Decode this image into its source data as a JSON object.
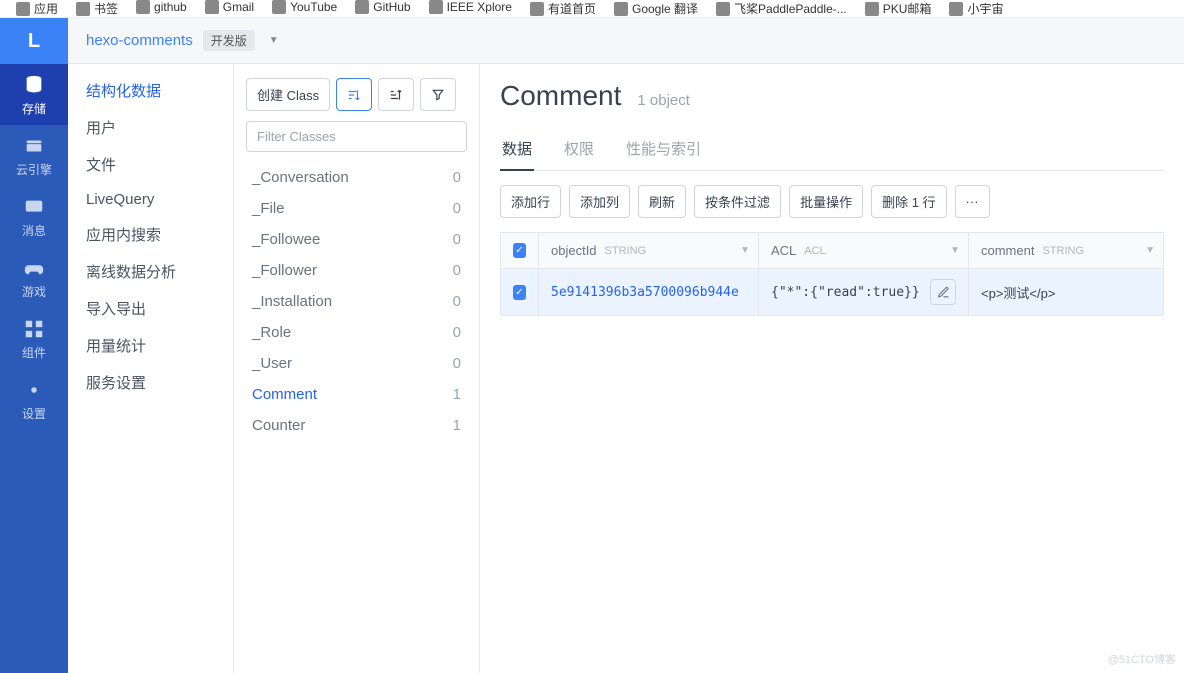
{
  "bookmarks": [
    "应用",
    "书签",
    "github",
    "Gmail",
    "YouTube",
    "GitHub",
    "IEEE Xplore",
    "有道首页",
    "Google 翻译",
    "飞桨PaddlePaddle-...",
    "PKU邮箱",
    "小宇宙"
  ],
  "logo": "L",
  "rail": [
    {
      "label": "存储",
      "icon": "database"
    },
    {
      "label": "云引擎",
      "icon": "cloud"
    },
    {
      "label": "消息",
      "icon": "message"
    },
    {
      "label": "游戏",
      "icon": "game"
    },
    {
      "label": "组件",
      "icon": "grid"
    },
    {
      "label": "设置",
      "icon": "gear"
    }
  ],
  "header": {
    "app_name": "hexo-comments",
    "version_badge": "开发版"
  },
  "sidebar": {
    "items": [
      "结构化数据",
      "用户",
      "文件",
      "LiveQuery",
      "应用内搜索",
      "离线数据分析",
      "导入导出",
      "用量统计",
      "服务设置"
    ]
  },
  "class_panel": {
    "create_label": "创建 Class",
    "filter_placeholder": "Filter Classes",
    "classes": [
      {
        "name": "_Conversation",
        "count": 0
      },
      {
        "name": "_File",
        "count": 0
      },
      {
        "name": "_Followee",
        "count": 0
      },
      {
        "name": "_Follower",
        "count": 0
      },
      {
        "name": "_Installation",
        "count": 0
      },
      {
        "name": "_Role",
        "count": 0
      },
      {
        "name": "_User",
        "count": 0
      },
      {
        "name": "Comment",
        "count": 1
      },
      {
        "name": "Counter",
        "count": 1
      }
    ],
    "active_index": 7
  },
  "main": {
    "title": "Comment",
    "object_count": "1 object",
    "tabs": [
      "数据",
      "权限",
      "性能与索引"
    ],
    "active_tab": 0,
    "actions": {
      "add_row": "添加行",
      "add_col": "添加列",
      "refresh": "刷新",
      "filter": "按条件过滤",
      "batch": "批量操作",
      "delete": "删除 1 行",
      "more": "···"
    },
    "columns": [
      {
        "name": "objectId",
        "type": "STRING"
      },
      {
        "name": "ACL",
        "type": "ACL"
      },
      {
        "name": "comment",
        "type": "STRING"
      }
    ],
    "rows": [
      {
        "objectId": "5e9141396b3a5700096b944e",
        "acl": "{\"*\":{\"read\":true}}",
        "comment": "<p>测试</p>"
      }
    ]
  },
  "watermark": "@51CTO博客"
}
